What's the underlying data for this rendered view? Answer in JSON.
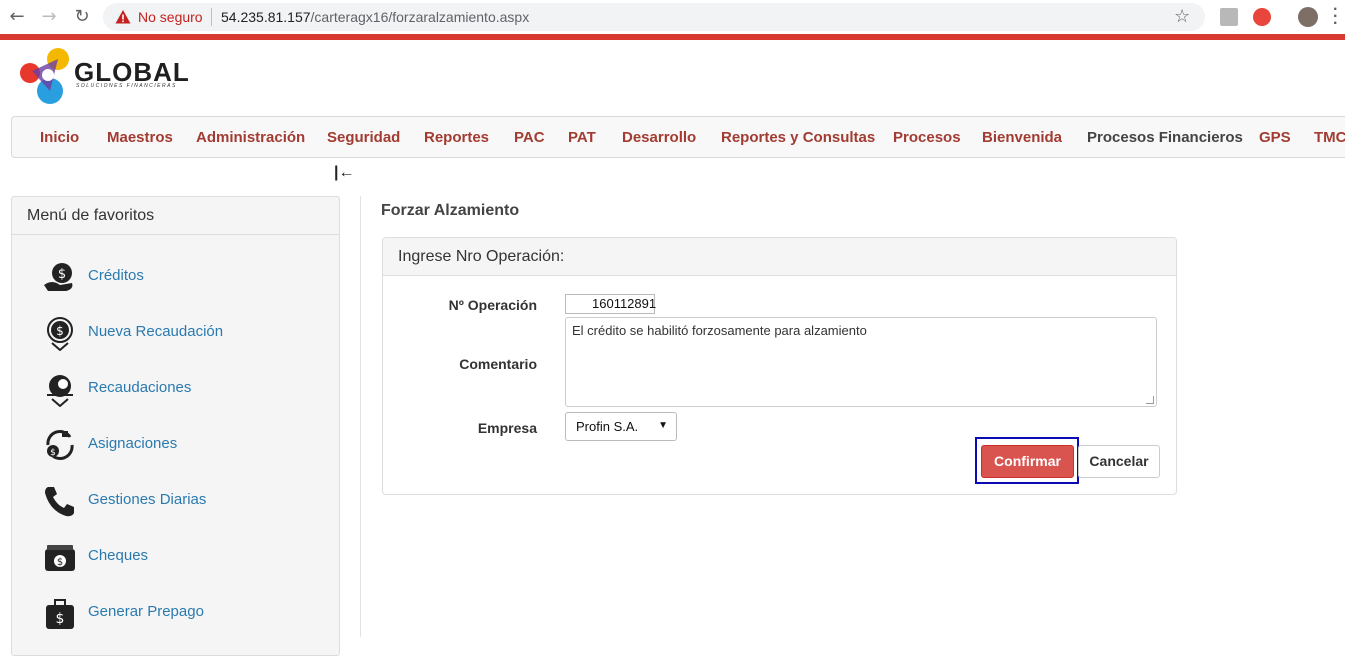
{
  "browser": {
    "security_label": "No seguro",
    "url_host": "54.235.81.157",
    "url_path": "/carteragx16/forzaralzamiento.aspx"
  },
  "logo": {
    "name": "GLOBAL",
    "tagline": "SOLUCIONES FINANCIERAS"
  },
  "menu": [
    "Inicio",
    "Maestros",
    "Administración",
    "Seguridad",
    "Reportes",
    "PAC",
    "PAT",
    "Desarrollo",
    "Reportes y Consultas",
    "Procesos",
    "Bienvenida",
    "Procesos Financieros",
    "GPS",
    "TMC"
  ],
  "sidebar": {
    "title": "Menú de favoritos",
    "items": [
      {
        "label": "Créditos",
        "icon": "money-hand-icon"
      },
      {
        "label": "Nueva Recaudación",
        "icon": "money-down-icon"
      },
      {
        "label": "Recaudaciones",
        "icon": "coins-down-icon"
      },
      {
        "label": "Asignaciones",
        "icon": "money-cycle-icon"
      },
      {
        "label": "Gestiones Diarias",
        "icon": "phone-icon"
      },
      {
        "label": "Cheques",
        "icon": "wallet-icon"
      },
      {
        "label": "Generar Prepago",
        "icon": "briefcase-money-icon"
      }
    ]
  },
  "main": {
    "title": "Forzar Alzamiento",
    "panel_heading": "Ingrese Nro Operación:",
    "operation_label": "Nº Operación",
    "operation_value": "160112891",
    "comment_label": "Comentario",
    "comment_value": "El crédito se habilitó forzosamente para alzamiento",
    "company_label": "Empresa",
    "company_value": "Profin S.A.",
    "confirm_label": "Confirmar",
    "cancel_label": "Cancelar"
  },
  "colors": {
    "accent_red": "#d93a2f",
    "menu_text": "#a23c32",
    "link_blue": "#2a7ab0",
    "highlight": "#0b0bb5"
  }
}
